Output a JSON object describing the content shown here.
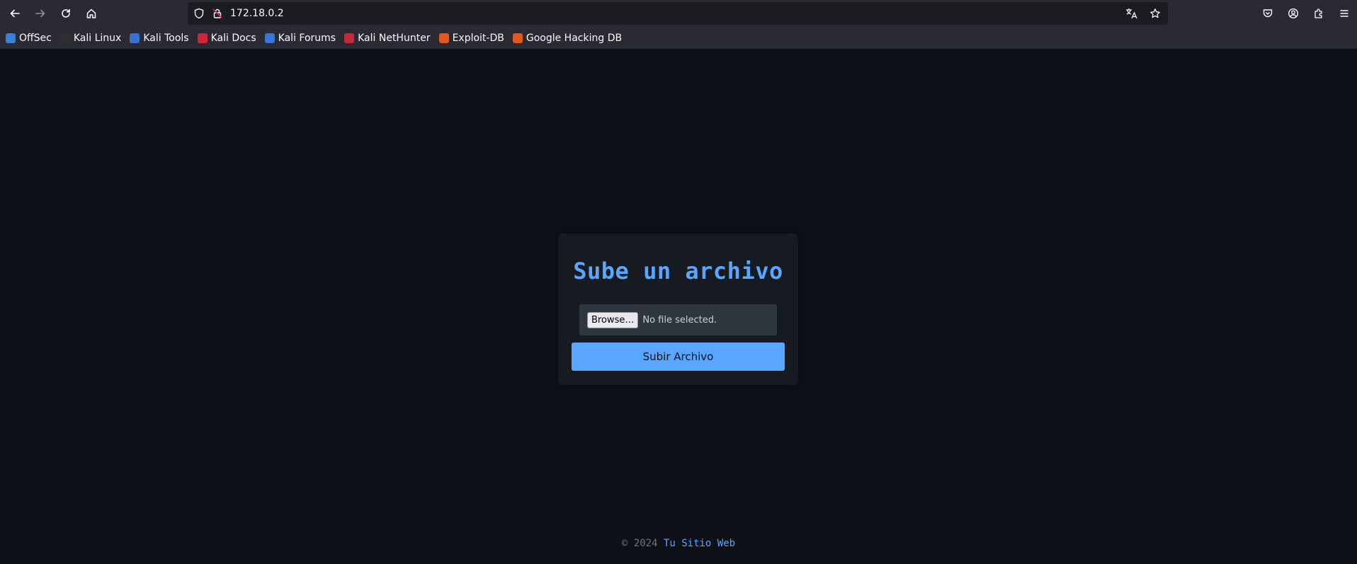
{
  "browser": {
    "url": "172.18.0.2",
    "bookmarks": [
      {
        "label": "OffSec",
        "color": "#3d7fd6"
      },
      {
        "label": "Kali Linux",
        "color": "#2f2f2f"
      },
      {
        "label": "Kali Tools",
        "color": "#3b6fd1"
      },
      {
        "label": "Kali Docs",
        "color": "#d0263b"
      },
      {
        "label": "Kali Forums",
        "color": "#3978d8"
      },
      {
        "label": "Kali NetHunter",
        "color": "#c6283a"
      },
      {
        "label": "Exploit-DB",
        "color": "#e2581f"
      },
      {
        "label": "Google Hacking DB",
        "color": "#e2581f"
      }
    ]
  },
  "upload": {
    "title": "Sube un archivo",
    "browse_label": "Browse…",
    "no_file_text": "No file selected.",
    "submit_label": "Subir Archivo"
  },
  "footer": {
    "copyright": "© 2024",
    "site_name": "Tu Sitio Web"
  },
  "colors": {
    "background": "#0d1117",
    "card": "#161b22",
    "accent": "#58a6ff"
  }
}
